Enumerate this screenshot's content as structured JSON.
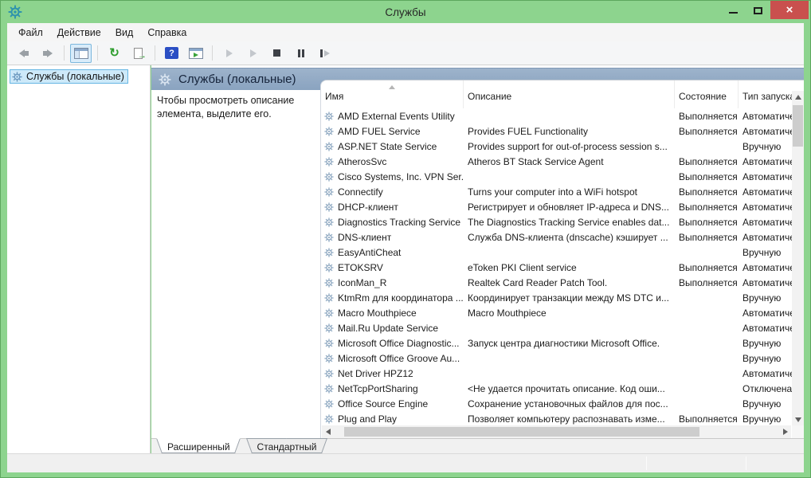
{
  "window": {
    "title": "Службы"
  },
  "window_controls": {
    "close_glyph": "×"
  },
  "menubar": {
    "items": [
      "Файл",
      "Действие",
      "Вид",
      "Справка"
    ]
  },
  "toolbar": {
    "buttons": [
      "back",
      "forward",
      "show-console-tree",
      "refresh",
      "export-list",
      "help",
      "show-action-pane",
      "start-service",
      "resume-service",
      "stop-service",
      "pause-service",
      "restart-service"
    ]
  },
  "sidebar": {
    "root": {
      "label": "Службы (локальные)",
      "icon": "gear-icon",
      "selected": true
    }
  },
  "main": {
    "banner": {
      "icon": "gear-icon",
      "title": "Службы (локальные)"
    },
    "description": {
      "text": "Чтобы просмотреть описание элемента, выделите его."
    },
    "table": {
      "columns": [
        "Имя",
        "Описание",
        "Состояние",
        "Тип запуска"
      ],
      "sort": {
        "column": "Имя",
        "direction": "asc"
      },
      "row_icon": "gear-icon",
      "rows": [
        {
          "name": "AMD External Events Utility",
          "description": "",
          "status": "Выполняется",
          "startup": "Автоматически"
        },
        {
          "name": "AMD FUEL Service",
          "description": "Provides FUEL Functionality",
          "status": "Выполняется",
          "startup": "Автоматически"
        },
        {
          "name": "ASP.NET State Service",
          "description": "Provides support for out-of-process session s...",
          "status": "",
          "startup": "Вручную"
        },
        {
          "name": "AtherosSvc",
          "description": "Atheros BT Stack Service Agent",
          "status": "Выполняется",
          "startup": "Автоматически"
        },
        {
          "name": "Cisco Systems, Inc. VPN Ser...",
          "description": "",
          "status": "Выполняется",
          "startup": "Автоматически"
        },
        {
          "name": "Connectify",
          "description": "Turns your computer into a WiFi hotspot",
          "status": "Выполняется",
          "startup": "Автоматически"
        },
        {
          "name": "DHCP-клиент",
          "description": "Регистрирует и обновляет IP-адреса и DNS...",
          "status": "Выполняется",
          "startup": "Автоматически"
        },
        {
          "name": "Diagnostics Tracking Service",
          "description": "The Diagnostics Tracking Service enables dat...",
          "status": "Выполняется",
          "startup": "Автоматически"
        },
        {
          "name": "DNS-клиент",
          "description": "Служба DNS-клиента (dnscache) кэширует ...",
          "status": "Выполняется",
          "startup": "Автоматически"
        },
        {
          "name": "EasyAntiCheat",
          "description": "",
          "status": "",
          "startup": "Вручную"
        },
        {
          "name": "ETOKSRV",
          "description": "eToken PKI Client service",
          "status": "Выполняется",
          "startup": "Автоматически"
        },
        {
          "name": "IconMan_R",
          "description": "Realtek Card Reader Patch Tool.",
          "status": "Выполняется",
          "startup": "Автоматически"
        },
        {
          "name": "KtmRm для координатора ...",
          "description": "Координирует транзакции между MS DTC и...",
          "status": "",
          "startup": "Вручную"
        },
        {
          "name": "Macro Mouthpiece",
          "description": "Macro Mouthpiece",
          "status": "",
          "startup": "Автоматически"
        },
        {
          "name": "Mail.Ru Update Service",
          "description": "",
          "status": "",
          "startup": "Автоматически"
        },
        {
          "name": "Microsoft Office Diagnostic...",
          "description": "Запуск центра диагностики Microsoft Office.",
          "status": "",
          "startup": "Вручную"
        },
        {
          "name": "Microsoft Office Groove Au...",
          "description": "",
          "status": "",
          "startup": "Вручную"
        },
        {
          "name": "Net Driver HPZ12",
          "description": "",
          "status": "",
          "startup": "Автоматически"
        },
        {
          "name": "NetTcpPortSharing",
          "description": "<Не удается прочитать описание. Код оши...",
          "status": "",
          "startup": "Отключена"
        },
        {
          "name": "Office  Source Engine",
          "description": "Сохранение установочных файлов для пос...",
          "status": "",
          "startup": "Вручную"
        },
        {
          "name": "Plug and Play",
          "description": "Позволяет компьютеру распознавать изме...",
          "status": "Выполняется",
          "startup": "Вручную"
        }
      ]
    }
  },
  "tabs": {
    "items": [
      "Расширенный",
      "Стандартный"
    ],
    "active": "Расширенный"
  },
  "colors": {
    "titlebar_green": "#8dd48e",
    "close_button_red": "#c9504e",
    "banner_blue": "#94aac5",
    "selection_blue": "#cde9f9",
    "help_icon_blue": "#2b4fc4"
  }
}
